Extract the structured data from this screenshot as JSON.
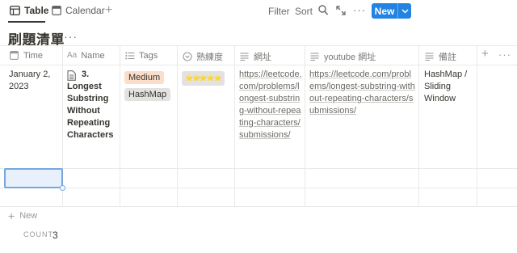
{
  "views": {
    "table_label": "Table",
    "calendar_label": "Calendar",
    "add_view": "+"
  },
  "toolbar": {
    "filter_label": "Filter",
    "sort_label": "Sort",
    "more": "···",
    "new_label": "New"
  },
  "database": {
    "title": "刷題清單",
    "more": "···"
  },
  "columns": [
    {
      "label": "Time",
      "icon": "calendar-icon"
    },
    {
      "label": "Name",
      "icon": "text-aa-icon",
      "icon_text": "Aa"
    },
    {
      "label": "Tags",
      "icon": "list-icon"
    },
    {
      "label": "熟練度",
      "icon": "select-circle-icon"
    },
    {
      "label": "網址",
      "icon": "text-lines-icon"
    },
    {
      "label": "youtube 網址",
      "icon": "text-lines-icon"
    },
    {
      "label": "備註",
      "icon": "text-lines-icon"
    }
  ],
  "add_property": "+",
  "more_properties": "···",
  "rows": [
    {
      "time": "January 2, 2023",
      "name": "3. Longest Substring Without Repeating Characters",
      "tags": [
        "Medium",
        "HashMap"
      ],
      "proficiency": "⭐⭐⭐⭐⭐",
      "url": "https://leetcode.com/problems/longest-substring-without-repeating-characters/submissions/",
      "youtube_url": "https://leetcode.com/problems/longest-substring-without-repeating-characters/submissions/",
      "notes": "HashMap / Sliding Window"
    }
  ],
  "tag_colors": {
    "Medium": "#fadec9",
    "HashMap": "#e3e2e0"
  },
  "footer": {
    "new_label": "New",
    "count_label": "COUNT",
    "count_value": "3"
  },
  "colors": {
    "accent": "#2383e2",
    "border": "#e9e9e7",
    "muted": "#9b9a97"
  }
}
